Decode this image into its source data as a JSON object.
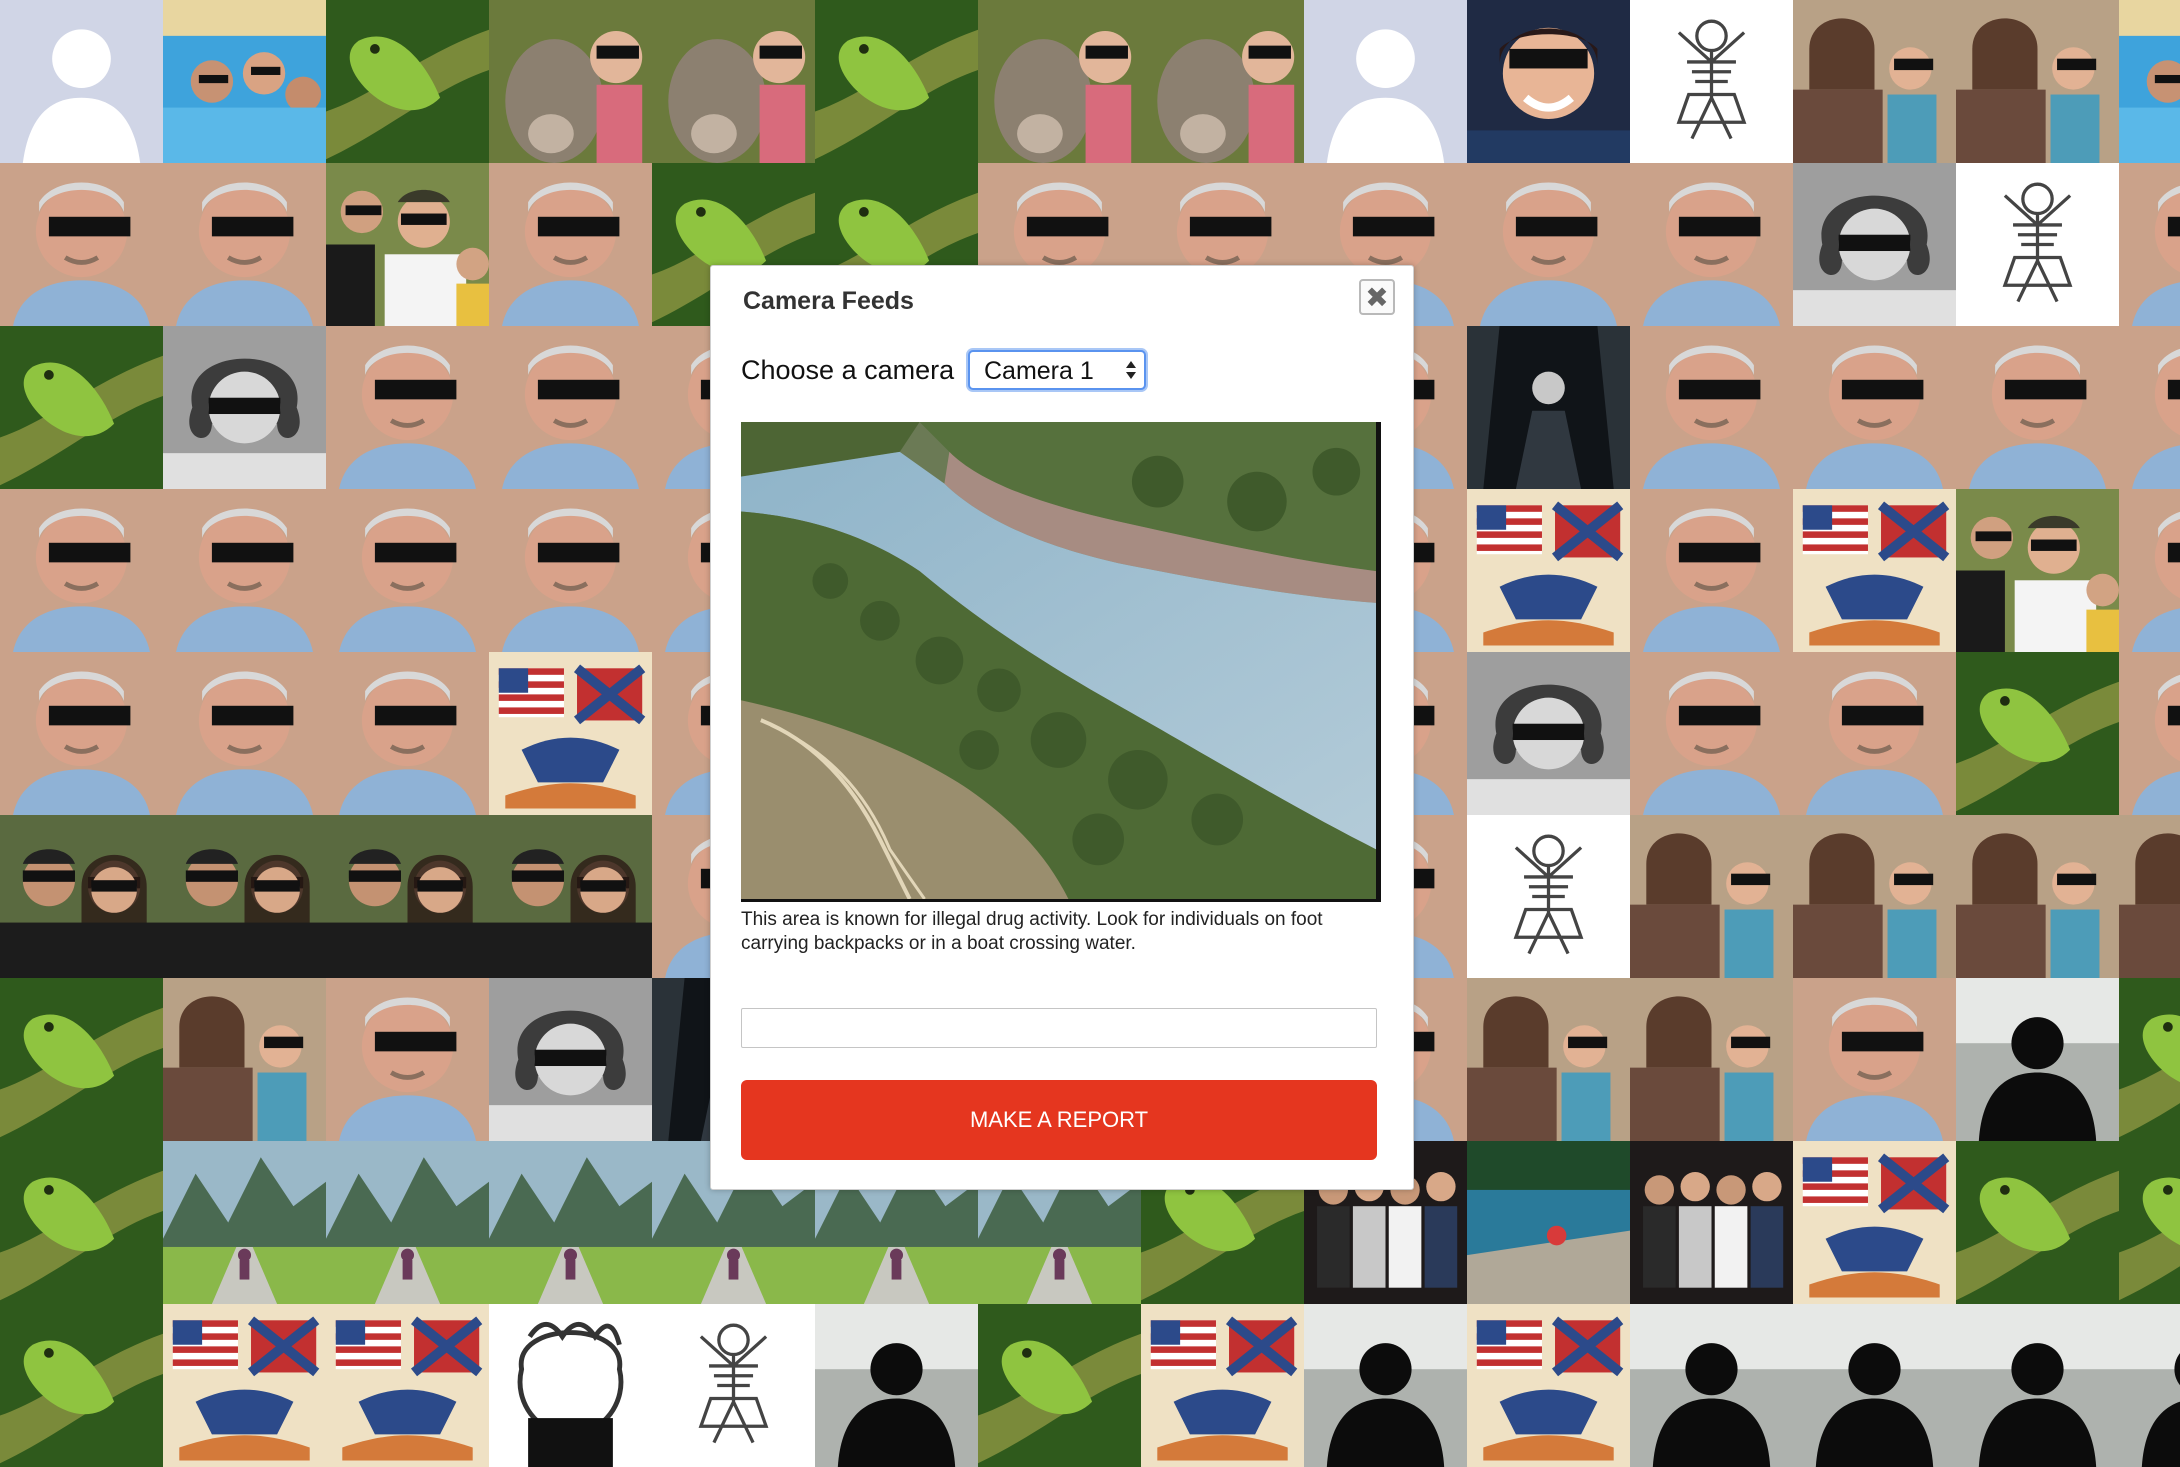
{
  "modal": {
    "title": "Camera Feeds",
    "close_icon": "close-icon",
    "close_glyph": "✖",
    "choose_label": "Choose a camera",
    "camera_select": {
      "selected": "Camera 1",
      "options": [
        "Camera 1"
      ]
    },
    "feed_description": "This area is known for illegal drug activity. Look for individuals on foot carrying backpacks or in a boat crossing water.",
    "report_input": {
      "value": "",
      "placeholder": ""
    },
    "report_button": "MAKE A REPORT"
  },
  "colors": {
    "report_button": "#e5361f",
    "select_focus": "#5a93ef",
    "modal_background": "#ffffff"
  },
  "background_mosaic": {
    "tiles": [
      "silhouette",
      "pool",
      "iguana",
      "donkey",
      "donkey",
      "iguana",
      "donkey",
      "donkey",
      "silhouette",
      "boy",
      "skeleton",
      "mother-child",
      "mother-child",
      "pool",
      "man",
      "man",
      "dad-kids",
      "man",
      "iguana",
      "iguana",
      "man",
      "man",
      "man",
      "man",
      "man",
      "old-girl",
      "skeleton",
      "man",
      "iguana",
      "old-girl",
      "man",
      "man",
      "man",
      "man",
      "man",
      "man",
      "man",
      "dark-figure",
      "man",
      "man",
      "man",
      "man",
      "man",
      "man",
      "man",
      "man",
      "man",
      "man",
      "man",
      "man",
      "man",
      "flags",
      "man",
      "flags",
      "dad-kids",
      "man",
      "man",
      "man",
      "man",
      "flags",
      "man",
      "man",
      "man",
      "man",
      "man",
      "old-girl",
      "man",
      "man",
      "iguana",
      "man",
      "couple",
      "couple",
      "couple",
      "couple",
      "man",
      "man",
      "man",
      "man",
      "man",
      "skeleton",
      "mother-child",
      "mother-child",
      "mother-child",
      "mother-child",
      "iguana",
      "mother-child",
      "man",
      "old-girl",
      "dark-figure",
      "man",
      "man",
      "man",
      "man",
      "mother-child",
      "mother-child",
      "man",
      "dark-silhouette",
      "iguana",
      "iguana",
      "valley",
      "valley",
      "valley",
      "valley",
      "valley",
      "valley",
      "iguana",
      "group",
      "lake",
      "group",
      "flags",
      "iguana",
      "iguana",
      "iguana",
      "flags",
      "flags",
      "sketch-head",
      "skeleton",
      "dark-silhouette",
      "iguana",
      "flags",
      "dark-silhouette",
      "flags",
      "dark-silhouette",
      "dark-silhouette",
      "dark-silhouette",
      "dark-silhouette"
    ]
  }
}
